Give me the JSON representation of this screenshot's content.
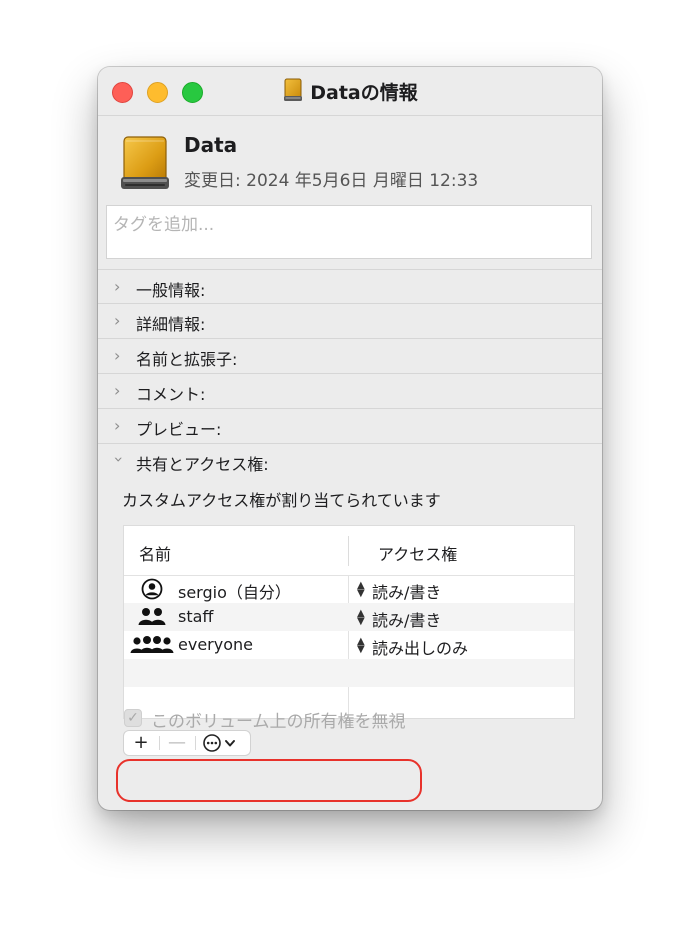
{
  "window": {
    "title": "Dataの情報"
  },
  "header": {
    "volume_name": "Data",
    "modified": "変更日: 2024 年5月6日 月曜日 12:33"
  },
  "tags": {
    "placeholder": "タグを追加..."
  },
  "sections": [
    {
      "label": "一般情報:",
      "expanded": false
    },
    {
      "label": "詳細情報:",
      "expanded": false
    },
    {
      "label": "名前と拡張子:",
      "expanded": false
    },
    {
      "label": "コメント:",
      "expanded": false
    },
    {
      "label": "プレビュー:",
      "expanded": false
    },
    {
      "label": "共有とアクセス権:",
      "expanded": true
    }
  ],
  "sharing": {
    "note": "カスタムアクセス権が割り当てられています",
    "columns": {
      "name": "名前",
      "access": "アクセス権"
    },
    "rows": [
      {
        "name": "sergio（自分）",
        "access": "読み/書き",
        "icon": "single-user-icon"
      },
      {
        "name": "staff",
        "access": "読み/書き",
        "icon": "group-icon"
      },
      {
        "name": "everyone",
        "access": "読み出しのみ",
        "icon": "everyone-icon"
      }
    ],
    "buttons": {
      "add": "+",
      "remove": "—"
    },
    "ignore_ownership_label": "このボリューム上の所有権を無視",
    "ignore_ownership_checked": true
  },
  "colors": {
    "highlight": "#e8322b",
    "drive": "#e0a217"
  }
}
